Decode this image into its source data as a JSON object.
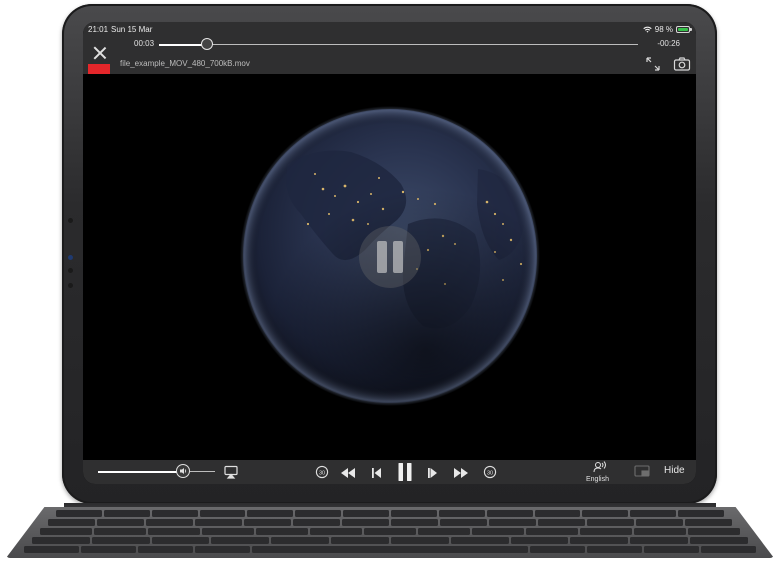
{
  "status_bar": {
    "time": "21:01",
    "date": "Sun 15 Mar",
    "battery_text": "98 %",
    "battery_level": 0.98,
    "wifi": "wifi-icon",
    "battery_color": "#37c24a"
  },
  "player": {
    "elapsed": "00:03",
    "remaining": "-00:26",
    "progress": 0.1,
    "file_name": "file_example_MOV_480_700kB.mov",
    "volume": 0.73,
    "subtitle_language": "English",
    "hide_label": "Hide",
    "state": "paused"
  },
  "colors": {
    "accent_red": "#e4262a",
    "bar_bg": "#2f2f30"
  },
  "icons": {
    "close": "close-icon",
    "expand": "expand-icon",
    "screenshot": "camera-icon",
    "airplay": "airplay-icon",
    "skip_back": "skip-back-30-icon",
    "rewind": "rewind-icon",
    "prev_frame": "previous-frame-icon",
    "play_pause": "pause-icon",
    "next_frame": "next-frame-icon",
    "fast_forward": "fast-forward-icon",
    "skip_forward": "skip-forward-30-icon",
    "audio_track": "audio-track-icon",
    "pip": "picture-in-picture-icon"
  }
}
